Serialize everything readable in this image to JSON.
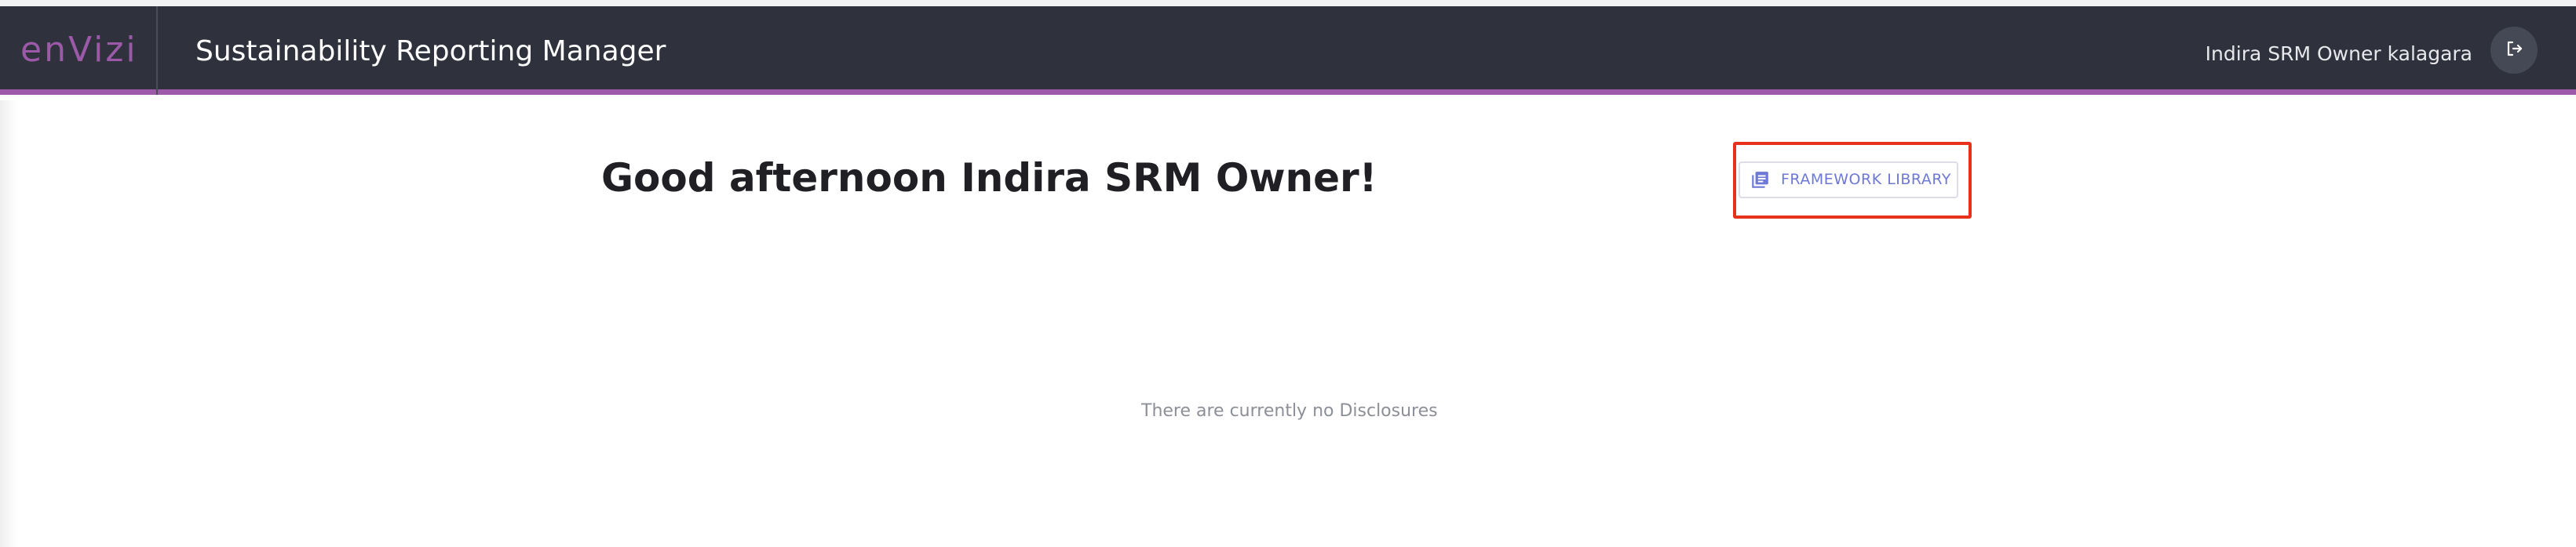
{
  "header": {
    "logo_text": "enVizi",
    "app_title": "Sustainability Reporting Manager",
    "user_name": "Indira SRM Owner kalagara",
    "logout_icon": "logout-icon",
    "accent_color": "#9b59a8"
  },
  "main": {
    "greeting": "Good afternoon Indira SRM Owner!",
    "framework_library_button": {
      "label": "FRAMEWORK LIBRARY",
      "icon": "library-books-icon",
      "highlight_color": "#e8311a"
    },
    "empty_state": "There are currently no Disclosures"
  }
}
